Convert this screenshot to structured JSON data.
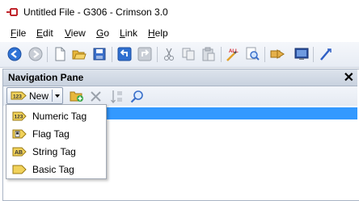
{
  "window": {
    "title": "Untitled File - G306 - Crimson 3.0"
  },
  "menu": {
    "items": [
      {
        "accel": "F",
        "rest": "ile"
      },
      {
        "accel": "E",
        "rest": "dit"
      },
      {
        "accel": "V",
        "rest": "iew"
      },
      {
        "accel": "G",
        "rest": "o"
      },
      {
        "accel": "L",
        "rest": "ink"
      },
      {
        "accel": "H",
        "rest": "elp"
      }
    ]
  },
  "toolbar": {
    "buttons": [
      "back-icon",
      "forward-icon",
      "new-file-icon",
      "open-folder-icon",
      "save-icon",
      "undo-icon",
      "redo-icon",
      "cut-icon",
      "copy-icon",
      "paste-icon",
      "spell-all-icon",
      "find-icon",
      "send-icon",
      "monitor-icon",
      "link-icon"
    ]
  },
  "nav_pane": {
    "title": "Navigation Pane",
    "close_glyph": "✕",
    "new_button_label": "New",
    "tag_icon_text": "123"
  },
  "dropdown": {
    "items": [
      {
        "label": "Numeric Tag",
        "icon": "numeric-tag-icon",
        "icon_text": "123"
      },
      {
        "label": "Flag Tag",
        "icon": "flag-tag-icon",
        "icon_text": ""
      },
      {
        "label": "String Tag",
        "icon": "string-tag-icon",
        "icon_text": "AB"
      },
      {
        "label": "Basic Tag",
        "icon": "basic-tag-icon",
        "icon_text": ""
      }
    ]
  }
}
